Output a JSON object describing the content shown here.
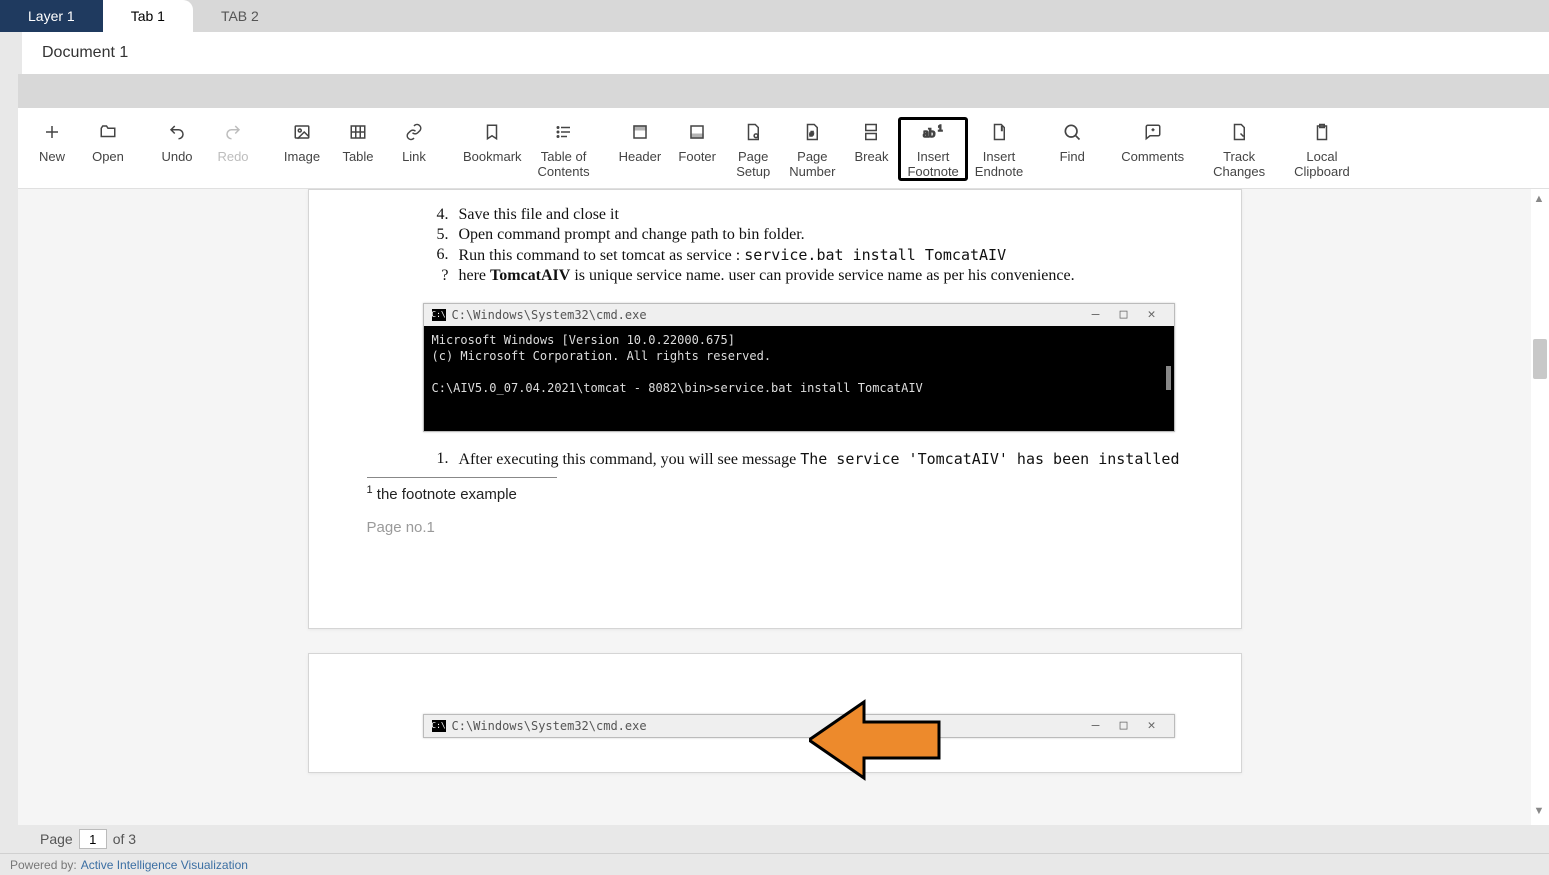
{
  "tabs": {
    "layer": "Layer 1",
    "tab1": "Tab 1",
    "tab2": "TAB 2"
  },
  "document_title": "Document 1",
  "toolbar": {
    "new": "New",
    "open": "Open",
    "undo": "Undo",
    "redo": "Redo",
    "image": "Image",
    "table": "Table",
    "link": "Link",
    "bookmark": "Bookmark",
    "toc": "Table of\nContents",
    "header": "Header",
    "footer": "Footer",
    "page_setup": "Page\nSetup",
    "page_number": "Page\nNumber",
    "break": "Break",
    "insert_footnote": "Insert\nFootnote",
    "insert_endnote": "Insert\nEndnote",
    "find": "Find",
    "comments": "Comments",
    "track_changes": "Track\nChanges",
    "local_clipboard": "Local\nClipboard"
  },
  "doc": {
    "items": [
      {
        "num": "4.",
        "text": "Save this file and close it"
      },
      {
        "num": "5.",
        "text": "Open command prompt and change path to bin folder."
      },
      {
        "num": "6.",
        "prefix": "Run this command to set tomcat as service : ",
        "code": "service.bat install TomcatAIV"
      },
      {
        "num": "?",
        "prefix": "here ",
        "bold": "TomcatAIV",
        "suffix": " is unique service name. user can provide service name as per his convenience."
      }
    ],
    "cmd_title_path": "C:\\Windows\\System32\\cmd.exe",
    "cmd_lines": [
      "Microsoft Windows [Version 10.0.22000.675]",
      "(c) Microsoft Corporation. All rights reserved.",
      "",
      "C:\\AIV5.0_07.04.2021\\tomcat - 8082\\bin>service.bat install TomcatAIV"
    ],
    "after_item_num": "1.",
    "after_item_text": "After executing this command, you will see message ",
    "after_item_code": "The service 'TomcatAIV' has been installed",
    "footnote_num": "1",
    "footnote_text": " the footnote example",
    "page_label": "Page no.1"
  },
  "pager": {
    "label_page": "Page",
    "current": "1",
    "label_of": "of",
    "total": "3"
  },
  "footer": {
    "powered_by_label": "Powered by:",
    "brand": "Active Intelligence Visualization"
  }
}
